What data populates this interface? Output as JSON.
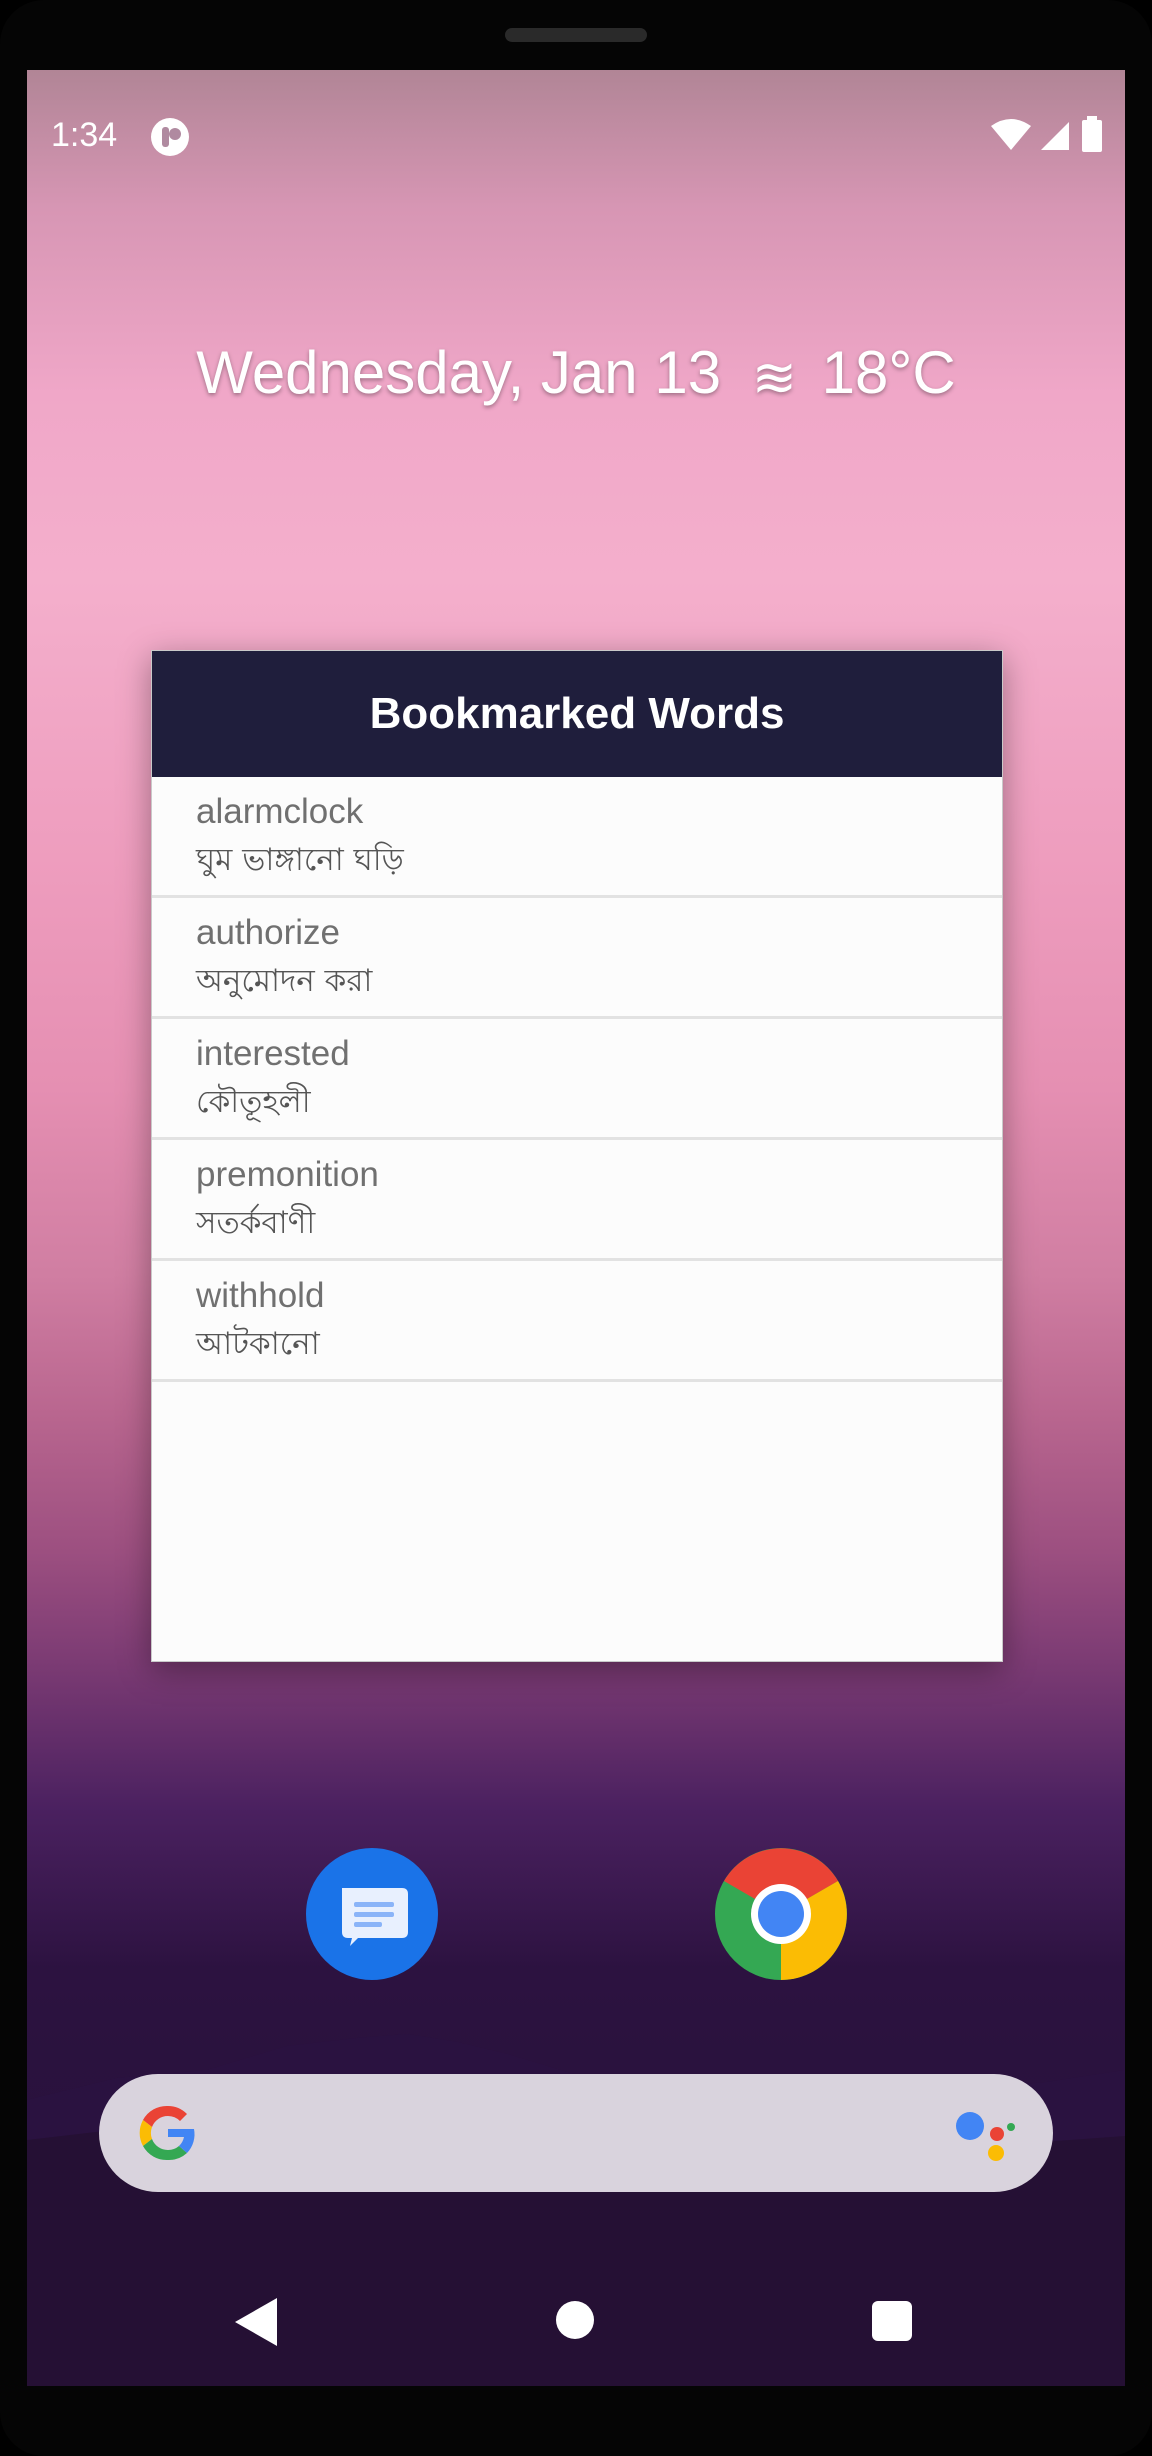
{
  "status_bar": {
    "time": "1:34"
  },
  "home": {
    "date": "Wednesday, Jan 13",
    "weather_icon": "haze-icon",
    "temperature": "18°C"
  },
  "widget": {
    "title": "Bookmarked Words",
    "words": [
      {
        "en": "alarmclock",
        "bn": "ঘুম ভাঙ্গানো ঘড়ি"
      },
      {
        "en": "authorize",
        "bn": "অনুমোদন করা"
      },
      {
        "en": "interested",
        "bn": "কৌতূহলী"
      },
      {
        "en": "premonition",
        "bn": "সতর্কবাণী"
      },
      {
        "en": "withhold",
        "bn": "আটকানো"
      }
    ]
  },
  "dock": [
    "messages-icon",
    "chrome-icon"
  ],
  "colors": {
    "widget_header": "#1f1e3c",
    "messages_blue": "#1a73e8",
    "search_bar": "#d9d3dd"
  }
}
